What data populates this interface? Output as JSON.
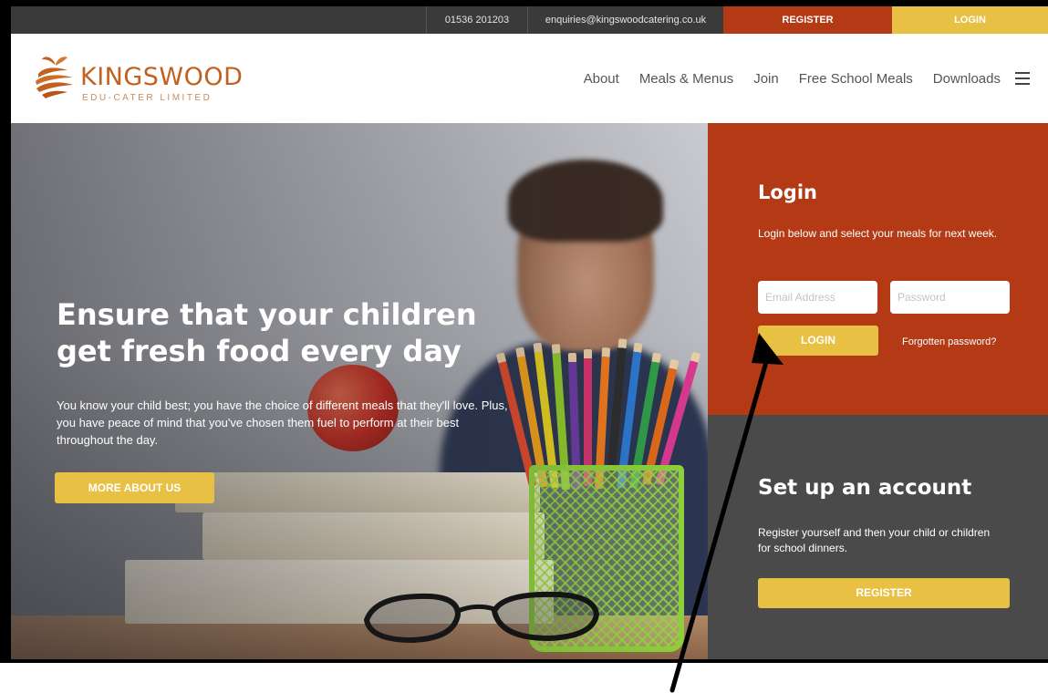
{
  "topbar": {
    "phone": "01536 201203",
    "email": "enquiries@kingswoodcatering.co.uk",
    "register_label": "REGISTER",
    "login_label": "LOGIN"
  },
  "logo": {
    "name": "KINGSWOOD",
    "tagline": "EDU-CATER LIMITED"
  },
  "nav": {
    "items": [
      "About",
      "Meals & Menus",
      "Join",
      "Free School Meals",
      "Downloads"
    ],
    "menu_icon": "hamburger-menu-icon"
  },
  "hero": {
    "title": "Ensure that your children get fresh food every day",
    "text": "You know your child best; you have the choice of different meals that they'll love. Plus, you have peace of mind that you've chosen them fuel to perform at their best throughout the day.",
    "button_label": "MORE ABOUT US"
  },
  "login_panel": {
    "title": "Login",
    "description": "Login below and select your meals for next week.",
    "email_placeholder": "Email Address",
    "password_placeholder": "Password",
    "login_label": "LOGIN",
    "forgot_label": "Forgotten password?"
  },
  "account_panel": {
    "title": "Set up an account",
    "description": "Register yourself and then your child or children for school dinners.",
    "register_label": "REGISTER"
  },
  "colors": {
    "accent_red": "#b33a14",
    "accent_yellow": "#e8c043",
    "dark_panel": "#4a4a4a",
    "topbar": "#3a3a3a",
    "logo_orange": "#c2601f"
  }
}
